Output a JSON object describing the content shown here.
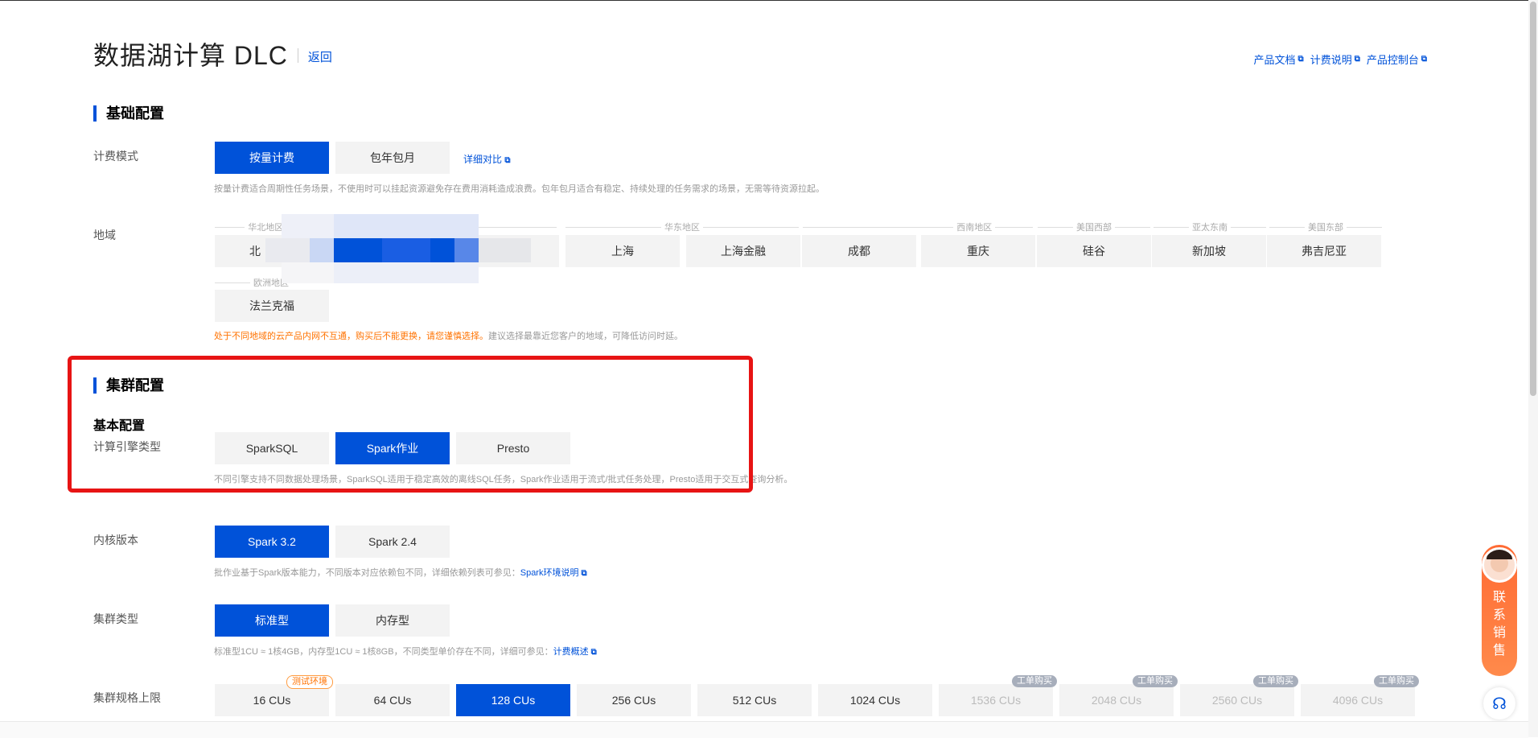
{
  "header": {
    "title": "数据湖计算 DLC",
    "back": "返回"
  },
  "top_links": [
    "产品文档",
    "计费说明",
    "产品控制台"
  ],
  "basic": {
    "title": "基础配置",
    "billing": {
      "label": "计费模式",
      "options": [
        "按量计费",
        "包年包月"
      ],
      "compare": "详细对比",
      "hint": "按量计费适合周期性任务场景，不使用时可以挂起资源避免存在费用消耗造成浪费。包年包月适合有稳定、持续处理的任务需求的场景，无需等待资源拉起。"
    },
    "region": {
      "label": "地域",
      "groups": [
        "华北地区",
        "华东地区",
        "西南地区",
        "美国西部",
        "亚太东南",
        "美国东部",
        "欧洲地区"
      ],
      "options": [
        "北",
        "上海",
        "上海金融",
        "成都",
        "重庆",
        "硅谷",
        "新加坡",
        "弗吉尼亚",
        "法兰克福"
      ],
      "hint_warn": "处于不同地域的云产品内网不互通，购买后不能更换，请您谨慎选择。",
      "hint": "建议选择最靠近您客户的地域，可降低访问时延。"
    }
  },
  "cluster": {
    "title": "集群配置",
    "basic_title": "基本配置",
    "engine": {
      "label": "计算引擎类型",
      "options": [
        "SparkSQL",
        "Spark作业",
        "Presto"
      ],
      "hint": "不同引擎支持不同数据处理场景，SparkSQL适用于稳定高效的离线SQL任务，Spark作业适用于流式/批式任务处理，Presto适用于交互式查询分析。"
    },
    "kernel": {
      "label": "内核版本",
      "options": [
        "Spark 3.2",
        "Spark 2.4"
      ],
      "hint": "批作业基于Spark版本能力，不同版本对应依赖包不同，详细依赖列表可参见：",
      "link": "Spark环境说明"
    },
    "type": {
      "label": "集群类型",
      "options": [
        "标准型",
        "内存型"
      ],
      "hint": "标准型1CU ≈ 1核4GB，内存型1CU ≈ 1核8GB，不同类型单价存在不同，详细可参见：",
      "link": "计费概述"
    },
    "spec": {
      "label": "集群规格上限",
      "options": [
        "16 CUs",
        "64 CUs",
        "128 CUs",
        "256 CUs",
        "512 CUs",
        "1024 CUs",
        "1536 CUs",
        "2048 CUs",
        "2560 CUs",
        "4096 CUs"
      ],
      "tag_test": "测试环境",
      "tag_buy": "工单购买"
    }
  },
  "contact": {
    "text": "联系销售"
  },
  "colors": {
    "primary": "#0052d9",
    "warn": "#ff7200",
    "highlight": "#e71414"
  }
}
